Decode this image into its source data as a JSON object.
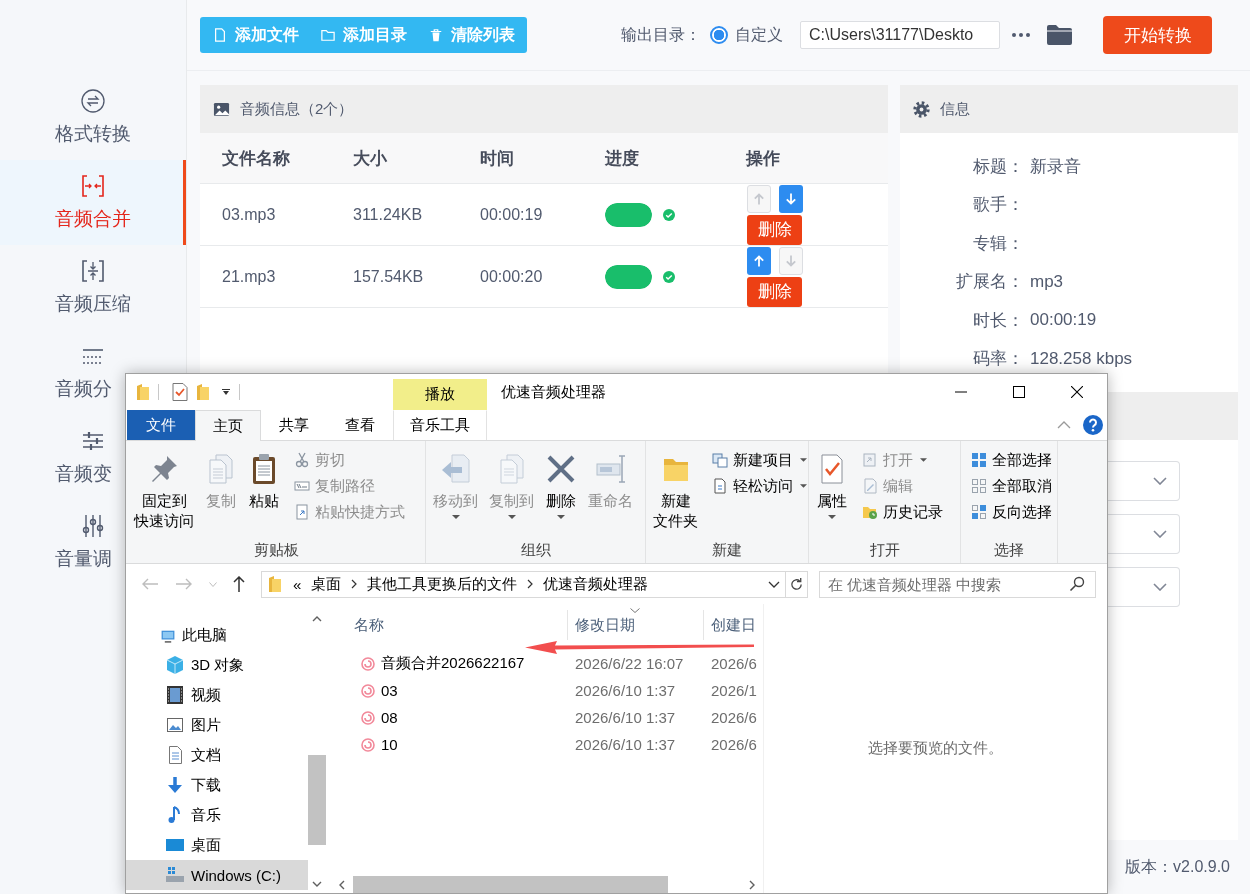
{
  "sidebar": {
    "items": [
      {
        "label": "格式转换",
        "selected": false
      },
      {
        "label": "音频合并",
        "selected": true
      },
      {
        "label": "音频压缩",
        "selected": false
      },
      {
        "label": "音频分",
        "selected": false
      },
      {
        "label": "音频变",
        "selected": false
      },
      {
        "label": "音量调",
        "selected": false
      }
    ]
  },
  "toolbar": {
    "buttons": [
      "添加文件",
      "添加目录",
      "清除列表"
    ],
    "output_label": "输出目录：",
    "mode": {
      "label": "自定义",
      "selected": true
    },
    "output_path": "C:\\Users\\31177\\Deskto",
    "start_button": "开始转换"
  },
  "audio_panel": {
    "title": "音频信息（2个）",
    "columns": [
      "文件名称",
      "大小",
      "时间",
      "进度",
      "操作"
    ],
    "rows": [
      {
        "name": "03.mp3",
        "size": "311.24KB",
        "duration": "00:00:19",
        "level": 1,
        "done": true,
        "up_disabled": true,
        "down_disabled": false,
        "delete": "删除"
      },
      {
        "name": "21.mp3",
        "size": "157.54KB",
        "duration": "00:00:20",
        "level": 1,
        "done": true,
        "up_disabled": false,
        "down_disabled": true,
        "delete": "删除"
      }
    ]
  },
  "info_panel": {
    "title": "信息",
    "fields": [
      {
        "label": "标题：",
        "value": "新录音"
      },
      {
        "label": "歌手："
      },
      {
        "label": "专辑："
      },
      {
        "label": "扩展名：",
        "value": "mp3"
      },
      {
        "label": "时长：",
        "value": "00:00:19"
      },
      {
        "label": "码率：",
        "value": "128.258 kbps"
      }
    ]
  },
  "settings_panel": {
    "dropdowns": [
      {
        "expanded": false
      },
      {
        "expanded": false
      },
      {
        "expanded": false
      }
    ]
  },
  "version": "版本：v2.0.9.0",
  "explorer": {
    "title": "优速音频处理器",
    "context_tab": "播放",
    "tabs": [
      {
        "label": "文件",
        "kind": "file",
        "selected": false
      },
      {
        "label": "主页",
        "kind": "tab",
        "selected": true
      },
      {
        "label": "共享",
        "kind": "tab",
        "selected": false
      },
      {
        "label": "查看",
        "kind": "tab",
        "selected": false
      },
      {
        "label": "音乐工具",
        "kind": "context",
        "selected": false
      }
    ],
    "ribbon": [
      {
        "label": "剪贴板",
        "items": [
          {
            "label": "固定到快速访问",
            "kind": "large",
            "disabled": false,
            "menu": false
          },
          {
            "label": "复制",
            "kind": "large",
            "disabled": true,
            "menu": false
          },
          {
            "label": "粘贴",
            "kind": "large",
            "disabled": false,
            "menu": false
          },
          {
            "label": "剪切",
            "kind": "small",
            "disabled": true,
            "menu": false
          },
          {
            "label": "复制路径",
            "kind": "small",
            "disabled": true,
            "menu": false
          },
          {
            "label": "粘贴快捷方式",
            "kind": "small",
            "disabled": true,
            "menu": false
          }
        ]
      },
      {
        "label": "组织",
        "items": [
          {
            "label": "移动到",
            "kind": "large",
            "disabled": true,
            "menu": true
          },
          {
            "label": "复制到",
            "kind": "large",
            "disabled": true,
            "menu": true
          },
          {
            "label": "删除",
            "kind": "large",
            "disabled": false,
            "menu": true
          },
          {
            "label": "重命名",
            "kind": "large",
            "disabled": true,
            "menu": false
          }
        ]
      },
      {
        "label": "新建",
        "items": [
          {
            "label": "新建文件夹",
            "kind": "large",
            "disabled": false,
            "menu": false
          },
          {
            "label": "新建项目",
            "kind": "small",
            "disabled": false,
            "menu": true
          },
          {
            "label": "轻松访问",
            "kind": "small",
            "disabled": false,
            "menu": true
          }
        ]
      },
      {
        "label": "打开",
        "items": [
          {
            "label": "属性",
            "kind": "large",
            "disabled": false,
            "menu": true
          },
          {
            "label": "打开",
            "kind": "small",
            "disabled": true,
            "menu": true
          },
          {
            "label": "编辑",
            "kind": "small",
            "disabled": true,
            "menu": false
          },
          {
            "label": "历史记录",
            "kind": "small",
            "disabled": false,
            "menu": false
          }
        ]
      },
      {
        "label": "选择",
        "items": [
          {
            "label": "全部选择",
            "kind": "small",
            "disabled": false,
            "menu": false
          },
          {
            "label": "全部取消",
            "kind": "small",
            "disabled": false,
            "menu": false
          },
          {
            "label": "反向选择",
            "kind": "small",
            "disabled": false,
            "menu": false
          }
        ]
      }
    ],
    "address": {
      "overflow_mark": "«",
      "crumbs": [
        "桌面",
        "其他工具更换后的文件",
        "优速音频处理器"
      ]
    },
    "search": {
      "placeholder": "在 优速音频处理器 中搜索"
    },
    "nav": [
      {
        "label": "此电脑",
        "selected": false,
        "children": [
          {
            "label": "3D 对象",
            "selected": false
          },
          {
            "label": "视频",
            "selected": false
          },
          {
            "label": "图片",
            "selected": false
          },
          {
            "label": "文档",
            "selected": false
          },
          {
            "label": "下载",
            "selected": false
          },
          {
            "label": "音乐",
            "selected": false
          },
          {
            "label": "桌面",
            "selected": false
          },
          {
            "label": "Windows (C:)",
            "selected": true
          }
        ]
      }
    ],
    "files": {
      "columns": [
        {
          "label": "名称",
          "sorted": false
        },
        {
          "label": "修改日期",
          "sorted": true
        },
        {
          "label": "创建日",
          "sorted": false
        }
      ],
      "rows": [
        {
          "name": "音频合并2026622167",
          "modified": "2026/6/22 16:07",
          "created": "2026/6"
        },
        {
          "name": "03",
          "modified": "2026/6/10 1:37",
          "created": "2026/1"
        },
        {
          "name": "08",
          "modified": "2026/6/10 1:37",
          "created": "2026/6"
        },
        {
          "name": "10",
          "modified": "2026/6/10 1:37",
          "created": "2026/6"
        }
      ]
    },
    "preview": "选择要预览的文件。"
  }
}
